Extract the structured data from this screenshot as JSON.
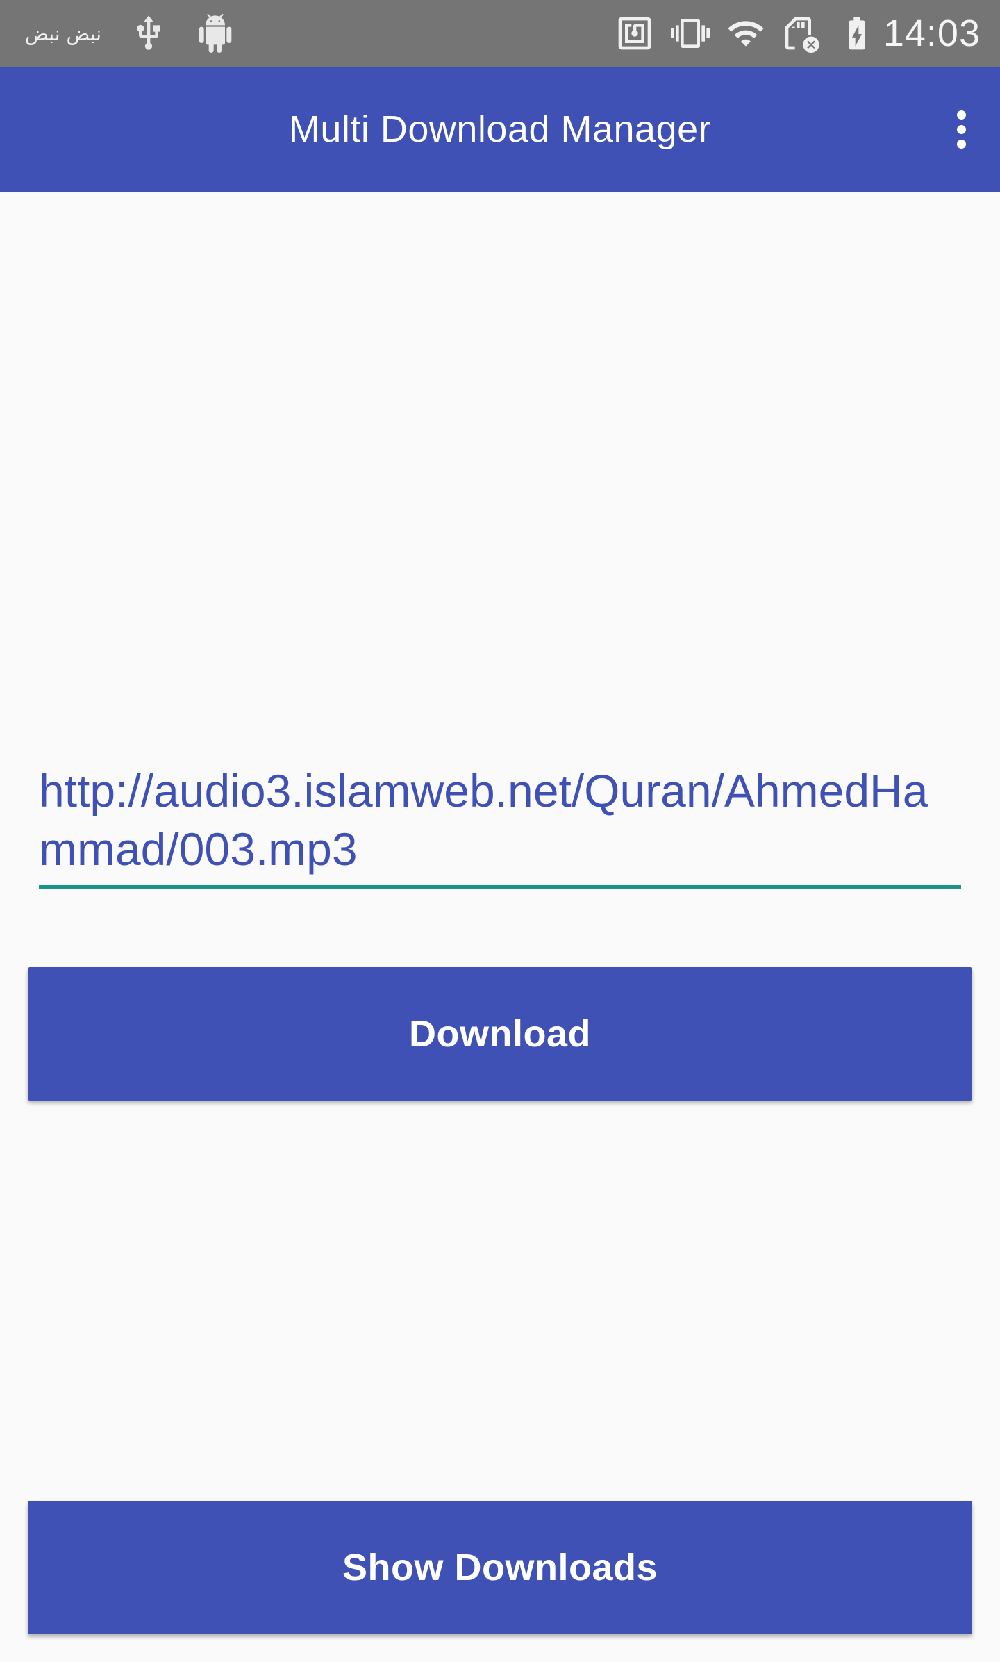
{
  "status_bar": {
    "notification_text": "نبض نبض",
    "time": "14:03",
    "icons": [
      "usb-icon",
      "android-debug-icon",
      "nfc-icon",
      "vibrate-icon",
      "wifi-icon",
      "sd-card-error-icon",
      "battery-charging-icon"
    ]
  },
  "app_bar": {
    "title": "Multi Download Manager",
    "overflow_icon": "more-vert-icon"
  },
  "main": {
    "url_value": "http://audio3.islamweb.net/Quran/AhmedHammad/003.mp3",
    "download_label": "Download",
    "show_downloads_label": "Show Downloads"
  },
  "colors": {
    "primary": "#3f51b5",
    "status_bar": "#757575",
    "accent_underline": "#1a9688",
    "background": "#fafafa"
  }
}
